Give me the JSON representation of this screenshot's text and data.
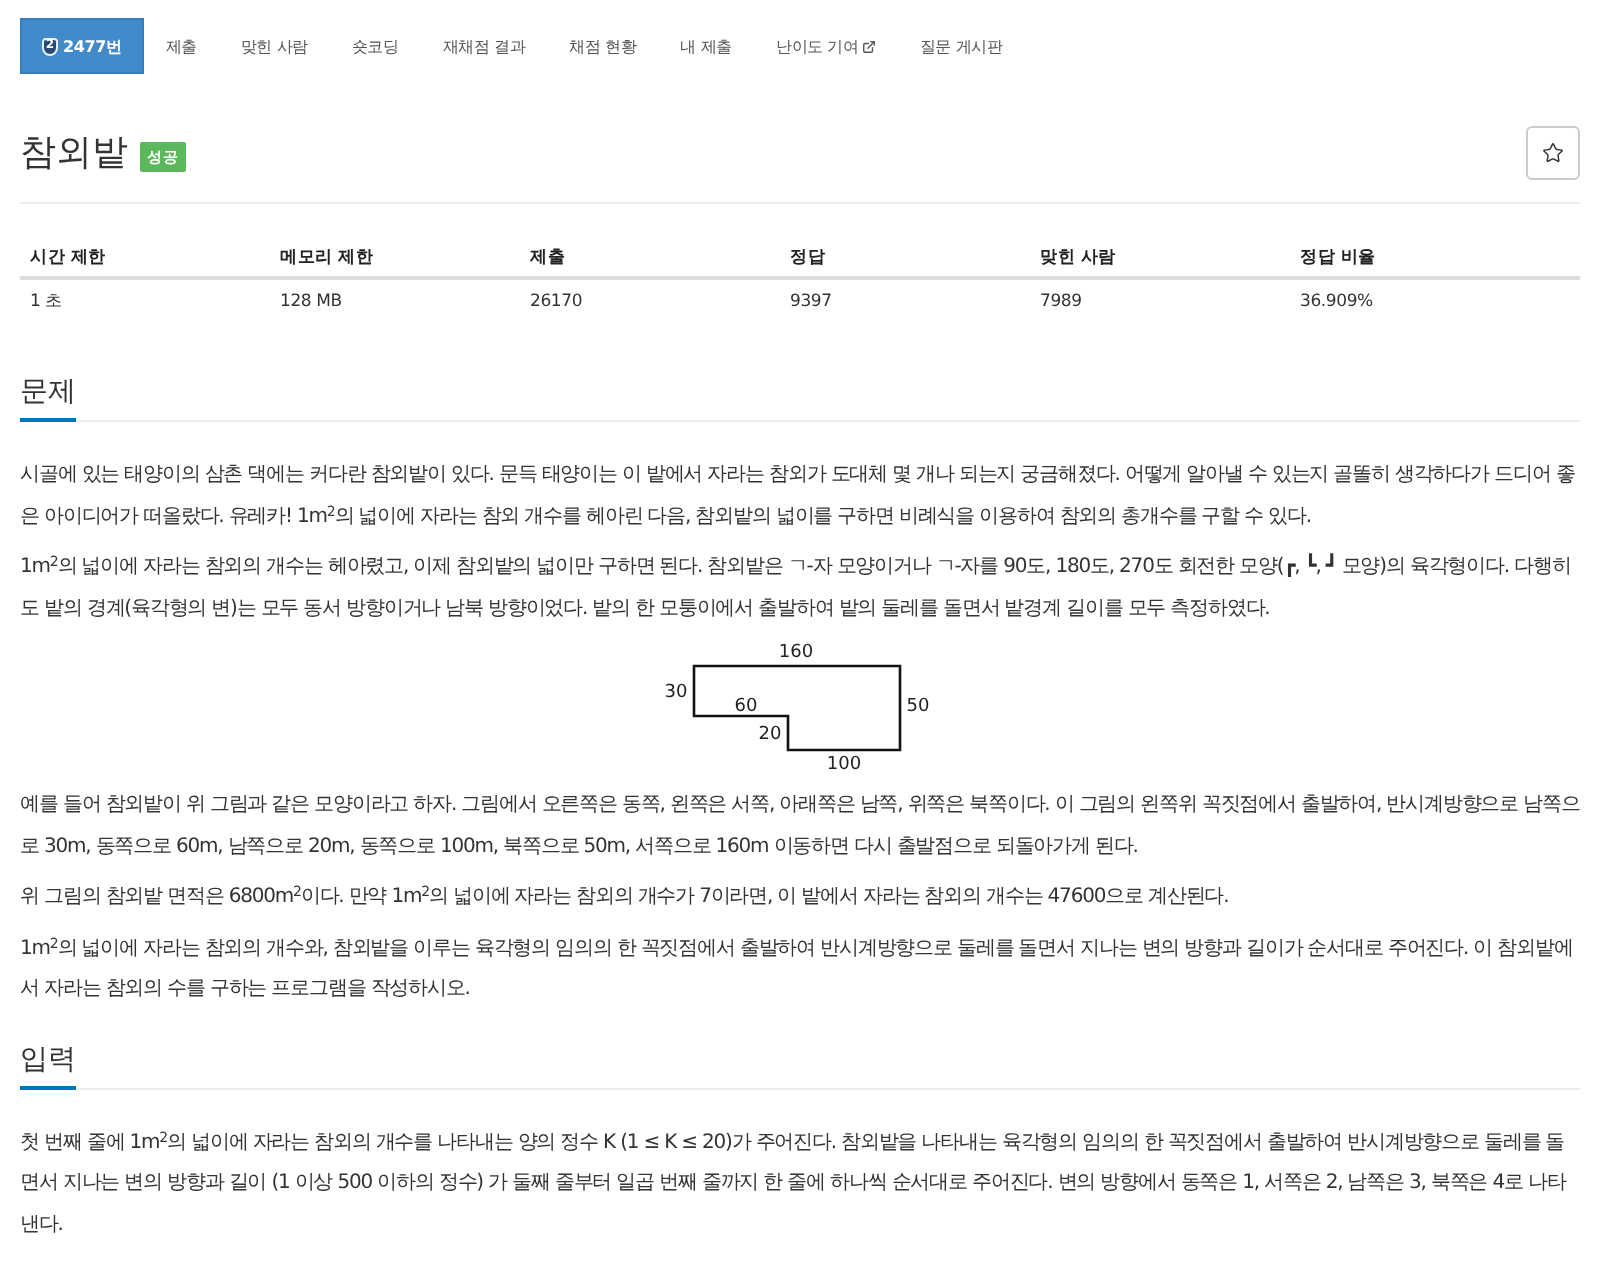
{
  "nav": {
    "tabs": [
      {
        "label": "2477번",
        "tier": "2",
        "selected": true,
        "external": false
      },
      {
        "label": "제출",
        "selected": false,
        "external": false
      },
      {
        "label": "맞힌 사람",
        "selected": false,
        "external": false
      },
      {
        "label": "숏코딩",
        "selected": false,
        "external": false
      },
      {
        "label": "재채점 결과",
        "selected": false,
        "external": false
      },
      {
        "label": "채점 현황",
        "selected": false,
        "external": false
      },
      {
        "label": "내 제출",
        "selected": false,
        "external": false
      },
      {
        "label": "난이도 기여",
        "selected": false,
        "external": true
      },
      {
        "label": "질문 게시판",
        "selected": false,
        "external": false
      }
    ]
  },
  "problem": {
    "title": "참외밭",
    "status": "성공"
  },
  "limits_table": {
    "columns": [
      "시간 제한",
      "메모리 제한",
      "제출",
      "정답",
      "맞힌 사람",
      "정답 비율"
    ],
    "rows": [
      [
        "1 초",
        "128 MB",
        "26170",
        "9397",
        "7989",
        "36.909%"
      ]
    ]
  },
  "sections": [
    {
      "heading": "문제",
      "blocks": [
        {
          "kind": "paragraph",
          "text": "시골에 있는 태양이의 삼촌 댁에는 커다란 참외밭이 있다. 문득 태양이는 이 밭에서 자라는 참외가 도대체 몇 개나 되는지 궁금해졌다. 어떻게 알아낼 수 있는지 골똘히 생각하다가 드디어 좋은 아이디어가 떠올랐다. 유레카! 1m$^{2}$의 넓이에 자라는 참외 개수를 헤아린 다음, 참외밭의 넓이를 구하면 비례식을 이용하여 참외의 총개수를 구할 수 있다."
        },
        {
          "kind": "paragraph",
          "text": "1m$^{2}$의 넓이에 자라는 참외의 개수는 헤아렸고, 이제 참외밭의 넓이만 구하면 된다. 참외밭은 ㄱ-자 모양이거나 ㄱ-자를 90도, 180도, 270도 회전한 모양(┏, ┗, ┛ 모양)의 육각형이다. 다행히도 밭의 경계(육각형의 변)는 모두 동서 방향이거나 남북 방향이었다. 밭의 한 모퉁이에서 출발하여 밭의 둘레를 돌면서 밭경계 길이를 모두 측정하였다."
        },
        {
          "kind": "figure",
          "edge_labels": [
            "160",
            "30",
            "60",
            "20",
            "50",
            "100"
          ]
        },
        {
          "kind": "paragraph",
          "text": "예를 들어 참외밭이 위 그림과 같은 모양이라고 하자. 그림에서 오른쪽은 동쪽, 왼쪽은 서쪽, 아래쪽은 남쪽, 위쪽은 북쪽이다. 이 그림의 왼쪽위 꼭짓점에서 출발하여, 반시계방향으로 남쪽으로 30m, 동쪽으로 60m, 남쪽으로 20m, 동쪽으로 100m, 북쪽으로 50m, 서쪽으로 160m 이동하면 다시 출발점으로 되돌아가게 된다."
        },
        {
          "kind": "paragraph",
          "text": "위 그림의 참외밭 면적은 6800m$^{2}$이다. 만약 1m$^{2}$의 넓이에 자라는 참외의 개수가 7이라면, 이 밭에서 자라는 참외의 개수는 47600으로 계산된다."
        },
        {
          "kind": "paragraph",
          "text": "1m$^{2}$의 넓이에 자라는 참외의 개수와, 참외밭을 이루는 육각형의 임의의 한 꼭짓점에서 출발하여 반시계방향으로 둘레를 돌면서 지나는 변의 방향과 길이가 순서대로 주어진다. 이 참외밭에서 자라는 참외의 수를 구하는 프로그램을 작성하시오."
        }
      ]
    },
    {
      "heading": "입력",
      "blocks": [
        {
          "kind": "paragraph",
          "text": "첫 번째 줄에 1m$^{2}$의 넓이에 자라는 참외의 개수를 나타내는 양의 정수 K (1 ≤ K ≤ 20)가 주어진다. 참외밭을 나타내는 육각형의 임의의 한 꼭짓점에서 출발하여 반시계방향으로 둘레를 돌면서 지나는 변의 방향과 길이 (1 이상 500 이하의 정수) 가 둘째 줄부터 일곱 번째 줄까지 한 줄에 하나씩 순서대로 주어진다. 변의 방향에서 동쪽은 1, 서쪽은 2, 남쪽은 3, 북쪽은 4로 나타낸다."
        }
      ]
    }
  ]
}
